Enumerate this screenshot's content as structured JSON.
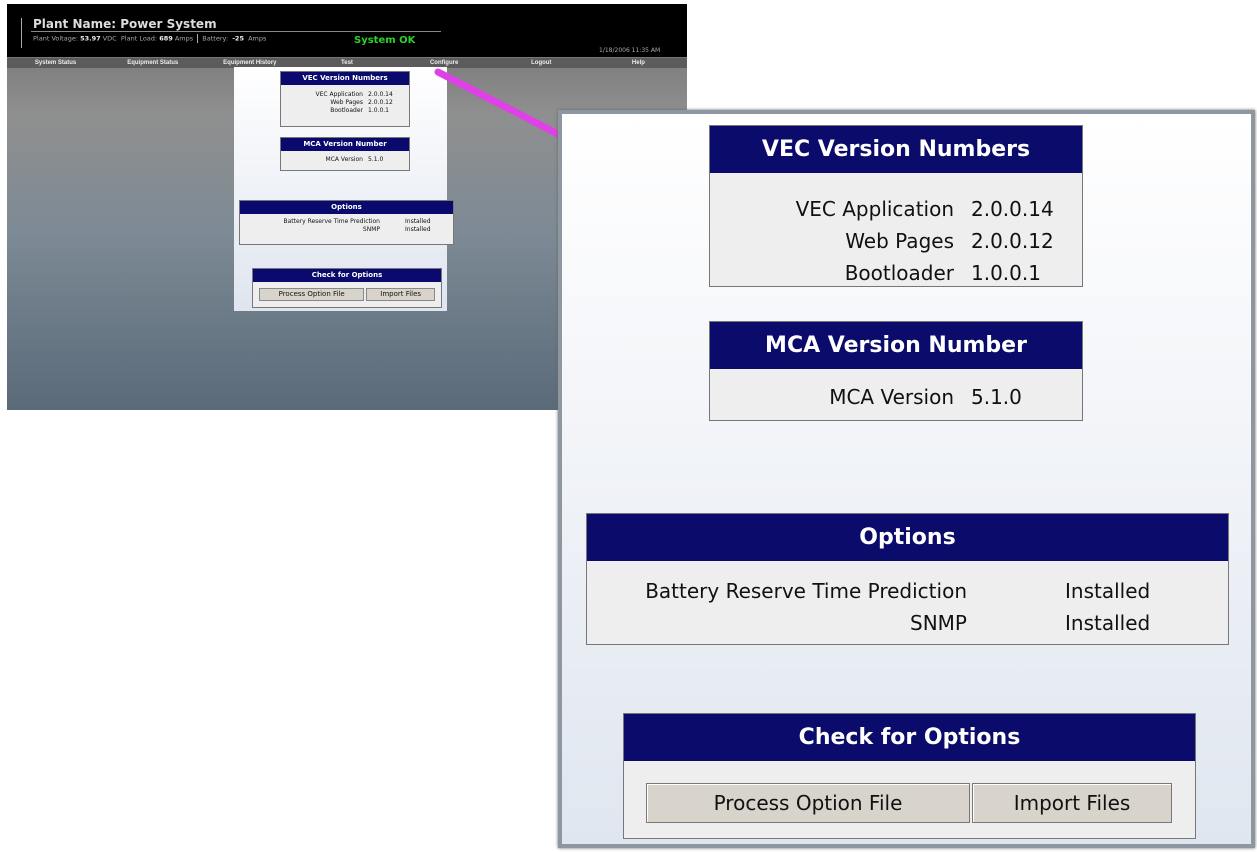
{
  "plant": {
    "title": "Plant Name:  Power System",
    "voltage_label": "Plant Voltage:",
    "voltage_value": "53.97",
    "voltage_unit": "VDC",
    "load_label": "Plant Load:",
    "load_value": "689",
    "load_unit": "Amps",
    "battery_label": "Battery:",
    "battery_value": "-25",
    "battery_unit": "Amps",
    "status": "System OK",
    "datetime": "1/18/2006 11:35 AM"
  },
  "nav": [
    "System Status",
    "Equipment Status",
    "Equipment History",
    "Test",
    "Configure",
    "Logout",
    "Help"
  ],
  "vec": {
    "header": "VEC Version Numbers",
    "rows": [
      {
        "label": "VEC Application",
        "value": "2.0.0.14"
      },
      {
        "label": "Web Pages",
        "value": "2.0.0.12"
      },
      {
        "label": "Bootloader",
        "value": "1.0.0.1"
      }
    ]
  },
  "mca": {
    "header": "MCA Version Number",
    "rows": [
      {
        "label": "MCA Version",
        "value": "5.1.0"
      }
    ]
  },
  "options": {
    "header": "Options",
    "rows": [
      {
        "label": "Battery Reserve Time Prediction",
        "value": "Installed"
      },
      {
        "label": "SNMP",
        "value": "Installed"
      }
    ]
  },
  "check": {
    "header": "Check for Options",
    "process_label": "Process Option File",
    "import_label": "Import Files"
  },
  "colors": {
    "header_bg": "#0b0b6b",
    "status_ok": "#2bd12b",
    "arrow": "#e040e8"
  }
}
